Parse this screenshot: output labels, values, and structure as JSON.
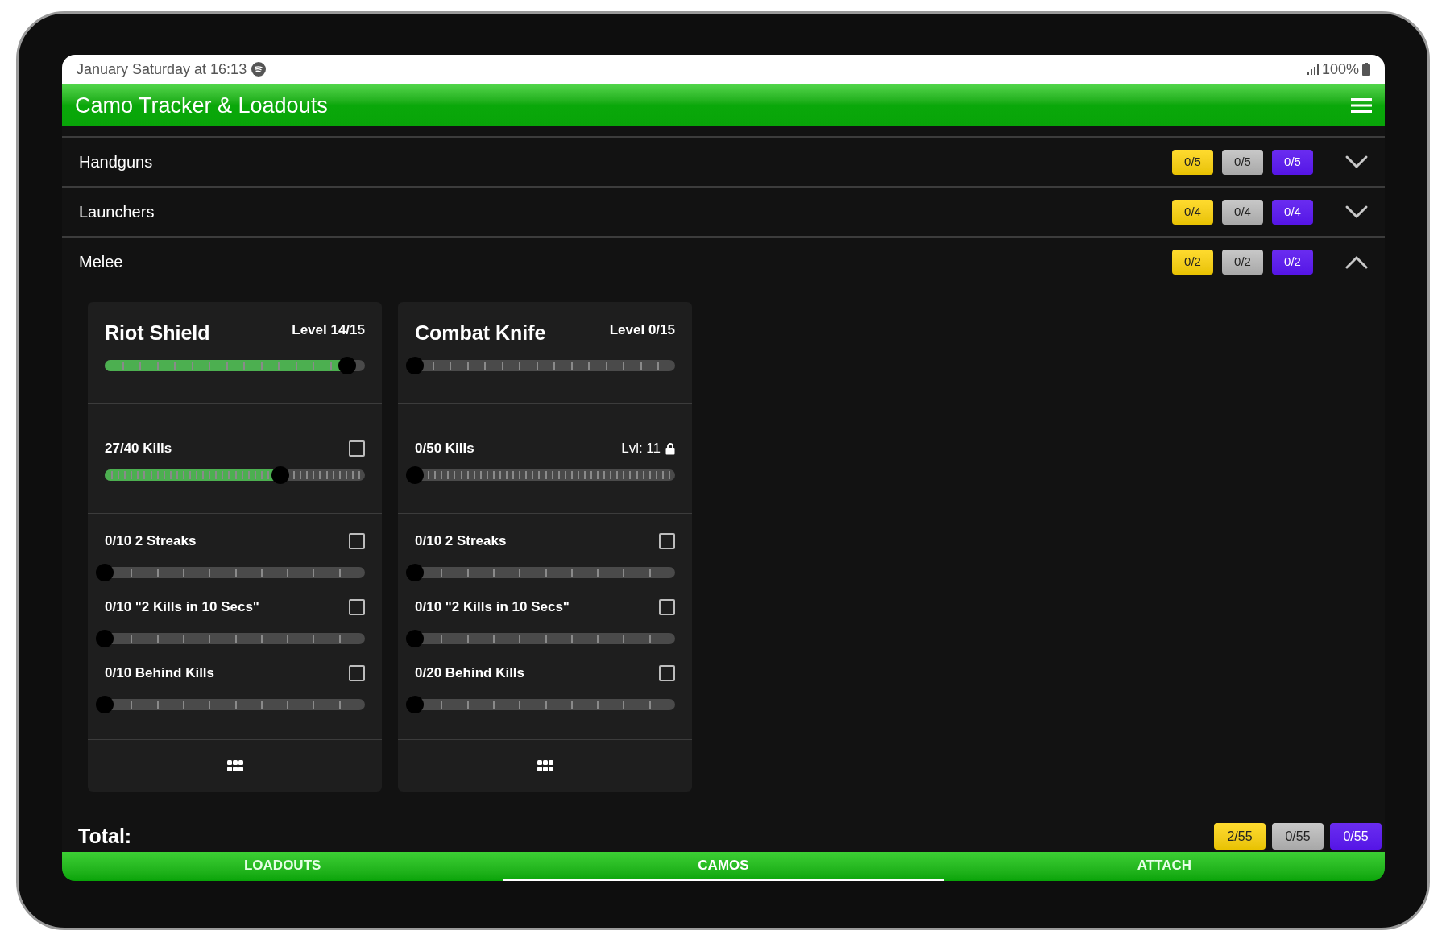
{
  "status_bar": {
    "time": "January Saturday at 16:13",
    "battery": "100%"
  },
  "app_bar": {
    "title": "Camo Tracker & Loadouts"
  },
  "sections": [
    {
      "name": "Handguns",
      "expanded": false,
      "badges": [
        {
          "kind": "gold",
          "text": "0/5"
        },
        {
          "kind": "platinum",
          "text": "0/5"
        },
        {
          "kind": "damascus",
          "text": "0/5"
        }
      ]
    },
    {
      "name": "Launchers",
      "expanded": false,
      "badges": [
        {
          "kind": "gold",
          "text": "0/4"
        },
        {
          "kind": "platinum",
          "text": "0/4"
        },
        {
          "kind": "damascus",
          "text": "0/4"
        }
      ]
    },
    {
      "name": "Melee",
      "expanded": true,
      "badges": [
        {
          "kind": "gold",
          "text": "0/2"
        },
        {
          "kind": "platinum",
          "text": "0/2"
        },
        {
          "kind": "damascus",
          "text": "0/2"
        }
      ],
      "weapons": [
        {
          "name": "Riot Shield",
          "level_label": "Level 14/15",
          "level": 0.9333,
          "kills": {
            "label": "27/40 Kills",
            "level": 0.675,
            "locked": false,
            "checked": false
          },
          "challenges": [
            {
              "label": "0/10 2 Streaks",
              "checked": false,
              "level": 0
            },
            {
              "label": "0/10 \"2 Kills in 10 Secs\"",
              "checked": false,
              "level": 0
            },
            {
              "label": "0/10 Behind Kills",
              "checked": false,
              "level": 0
            }
          ]
        },
        {
          "name": "Combat Knife",
          "level_label": "Level 0/15",
          "level": 0,
          "kills": {
            "label": "0/50 Kills",
            "level": 0,
            "locked": true,
            "unlock_label": "Lvl: 11"
          },
          "challenges": [
            {
              "label": "0/10 2 Streaks",
              "checked": false,
              "level": 0
            },
            {
              "label": "0/10 \"2 Kills in 10 Secs\"",
              "checked": false,
              "level": 0
            },
            {
              "label": "0/20 Behind Kills",
              "checked": false,
              "level": 0
            }
          ]
        }
      ]
    }
  ],
  "total": {
    "label": "Total:",
    "badges": [
      {
        "kind": "gold",
        "text": "2/55"
      },
      {
        "kind": "platinum",
        "text": "0/55"
      },
      {
        "kind": "damascus",
        "text": "0/55"
      }
    ]
  },
  "tabs": [
    {
      "label": "LOADOUTS",
      "selected": false
    },
    {
      "label": "CAMOS",
      "selected": true
    },
    {
      "label": "ATTACH",
      "selected": false
    }
  ]
}
